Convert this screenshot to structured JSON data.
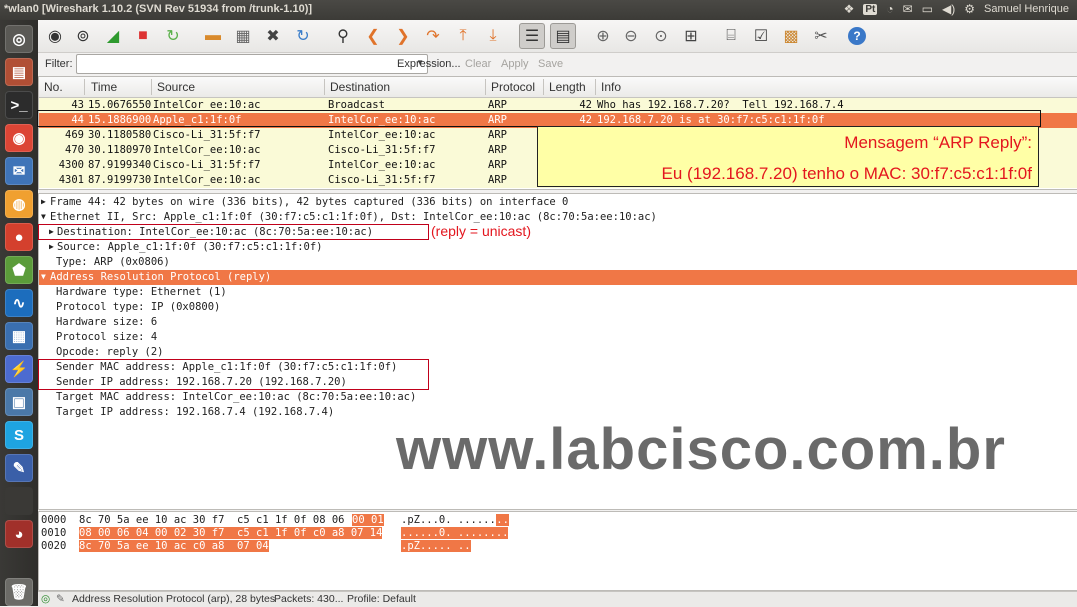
{
  "topbar": {
    "title": "*wlan0   [Wireshark 1.10.2  (SVN Rev 51934 from /trunk-1.10)]",
    "pt": "Pt",
    "user": "Samuel Henrique"
  },
  "filter": {
    "label": "Filter:",
    "value": "",
    "expression": "Expression...",
    "clear": "Clear",
    "apply": "Apply",
    "save": "Save"
  },
  "columns": [
    "No.",
    "Time",
    "Source",
    "Destination",
    "Protocol",
    "Length",
    "Info"
  ],
  "packets": [
    {
      "no": "43",
      "time": "15.0676550",
      "source": "IntelCor_ee:10:ac",
      "destination": "Broadcast",
      "protocol": "ARP",
      "length": "42",
      "info": "Who has 192.168.7.20?  Tell 192.168.7.4"
    },
    {
      "no": "44",
      "time": "15.1886900",
      "source": "Apple_c1:1f:0f",
      "destination": "IntelCor_ee:10:ac",
      "protocol": "ARP",
      "length": "42",
      "info": "192.168.7.20 is at 30:f7:c5:c1:1f:0f"
    },
    {
      "no": "469",
      "time": "30.1180580",
      "source": "Cisco-Li_31:5f:f7",
      "destination": "IntelCor_ee:10:ac",
      "protocol": "ARP",
      "length": "",
      "info": ""
    },
    {
      "no": "470",
      "time": "30.1180970",
      "source": "IntelCor_ee:10:ac",
      "destination": "Cisco-Li_31:5f:f7",
      "protocol": "ARP",
      "length": "",
      "info": ""
    },
    {
      "no": "4300",
      "time": "87.9199340",
      "source": "Cisco-Li_31:5f:f7",
      "destination": "IntelCor_ee:10:ac",
      "protocol": "ARP",
      "length": "",
      "info": ""
    },
    {
      "no": "4301",
      "time": "87.9199730",
      "source": "IntelCor_ee:10:ac",
      "destination": "Cisco-Li_31:5f:f7",
      "protocol": "ARP",
      "length": "",
      "info": ""
    }
  ],
  "details": [
    {
      "text": "Frame 44: 42 bytes on wire (336 bits), 42 bytes captured (336 bits) on interface 0",
      "indent": 0,
      "expander": "▶"
    },
    {
      "text": "Ethernet II, Src: Apple_c1:1f:0f (30:f7:c5:c1:1f:0f), Dst: IntelCor_ee:10:ac (8c:70:5a:ee:10:ac)",
      "indent": 0,
      "expander": "▼"
    },
    {
      "text": "Destination: IntelCor_ee:10:ac (8c:70:5a:ee:10:ac)",
      "indent": 1,
      "expander": "▶"
    },
    {
      "text": "Source: Apple_c1:1f:0f (30:f7:c5:c1:1f:0f)",
      "indent": 1,
      "expander": "▶"
    },
    {
      "text": "Type: ARP (0x0806)",
      "indent": 2,
      "expander": ""
    },
    {
      "text": "Address Resolution Protocol (reply)",
      "indent": 0,
      "expander": "▼"
    },
    {
      "text": "Hardware type: Ethernet (1)",
      "indent": 2,
      "expander": ""
    },
    {
      "text": "Protocol type: IP (0x0800)",
      "indent": 2,
      "expander": ""
    },
    {
      "text": "Hardware size: 6",
      "indent": 2,
      "expander": ""
    },
    {
      "text": "Protocol size: 4",
      "indent": 2,
      "expander": ""
    },
    {
      "text": "Opcode: reply (2)",
      "indent": 2,
      "expander": ""
    },
    {
      "text": "Sender MAC address: Apple_c1:1f:0f (30:f7:c5:c1:1f:0f)",
      "indent": 2,
      "expander": ""
    },
    {
      "text": "Sender IP address: 192.168.7.20 (192.168.7.20)",
      "indent": 2,
      "expander": ""
    },
    {
      "text": "Target MAC address: IntelCor_ee:10:ac (8c:70:5a:ee:10:ac)",
      "indent": 2,
      "expander": ""
    },
    {
      "text": "Target IP address: 192.168.7.4 (192.168.7.4)",
      "indent": 2,
      "expander": ""
    }
  ],
  "hex": [
    {
      "offset": "0000",
      "bytes_plain": "8c 70 5a ee 10 ac 30 f7  c5 c1 1f 0f 08 06 ",
      "bytes_hl": "00 01",
      "ascii_plain": ".pZ...0. ......",
      "ascii_hl": ".."
    },
    {
      "offset": "0010",
      "bytes_plain": "",
      "bytes_hl": "08 00 06 04 00 02 30 f7  c5 c1 1f 0f c0 a8 07 14",
      "ascii_plain": "",
      "ascii_hl": "......0. ........"
    },
    {
      "offset": "0020",
      "bytes_plain": "",
      "bytes_hl": "8c 70 5a ee 10 ac c0 a8  07 04",
      "ascii_plain": "",
      "ascii_hl": ".pZ..... .."
    }
  ],
  "annotations": {
    "callout_line1": "Mensagem “ARP Reply”:",
    "callout_line2": "Eu (192.168.7.20) tenho o MAC: 30:f7:c5:c1:1f:0f",
    "reply_note": "(reply = unicast)",
    "watermark": "www.labcisco.com.br"
  },
  "status": {
    "text": "Address Resolution Protocol (arp), 28 bytes",
    "packets": "Packets: 430...",
    "profile": "Profile: Default"
  },
  "colors": {
    "selection": "#f07746",
    "arp_row": "#fafad7",
    "annotation_red": "#e3161e",
    "callout_bg": "#ffffa6"
  }
}
